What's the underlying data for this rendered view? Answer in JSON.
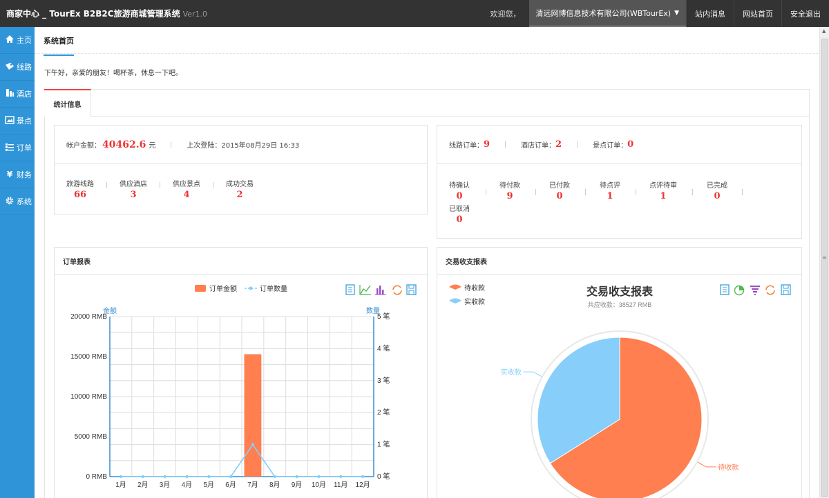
{
  "header": {
    "title": "商家中心 _ TourEx B2B2C旅游商城管理系统",
    "version": "Ver1.0",
    "welcome": "欢迎您，",
    "company": "清远网博信息技术有限公司(WBTourEx)",
    "nav": [
      "站内消息",
      "网站首页",
      "安全退出"
    ]
  },
  "sidebar": {
    "items": [
      {
        "label": "主页",
        "icon": "home-icon"
      },
      {
        "label": "线路",
        "icon": "route-icon"
      },
      {
        "label": "酒店",
        "icon": "hotel-icon"
      },
      {
        "label": "景点",
        "icon": "scenery-icon"
      },
      {
        "label": "订单",
        "icon": "list-icon"
      },
      {
        "label": "财务",
        "icon": "yen-icon"
      },
      {
        "label": "系统",
        "icon": "gear-icon"
      }
    ]
  },
  "page": {
    "tab": "系统首页",
    "greeting": "下午好，亲爱的朋友！喝杯茶，休息一下吧。",
    "panel_tab": "统计信息"
  },
  "account": {
    "balance_label": "帐户金额：",
    "balance": "40462.6",
    "balance_unit": "元",
    "last_login": "上次登陆：2015年08月29日 16:33",
    "stats": [
      {
        "label": "旅游线路",
        "value": "66"
      },
      {
        "label": "供应酒店",
        "value": "3"
      },
      {
        "label": "供应景点",
        "value": "4"
      },
      {
        "label": "成功交易",
        "value": "2"
      }
    ]
  },
  "orders": {
    "counts": [
      {
        "label": "线路订单：",
        "value": "9"
      },
      {
        "label": "酒店订单：",
        "value": "2"
      },
      {
        "label": "景点订单：",
        "value": "0"
      }
    ],
    "status": [
      {
        "label": "待确认",
        "value": "0"
      },
      {
        "label": "待付款",
        "value": "9"
      },
      {
        "label": "已付款",
        "value": "0"
      },
      {
        "label": "待点评",
        "value": "1"
      },
      {
        "label": "点评待审",
        "value": "1"
      },
      {
        "label": "已完成",
        "value": "0"
      },
      {
        "label": "已取消",
        "value": "0"
      }
    ]
  },
  "order_report": {
    "title": "订单报表",
    "legend": [
      "订单金额",
      "订单数量"
    ],
    "left_axis_label": "金额",
    "right_axis_label": "数量"
  },
  "trade_report": {
    "box_title": "交易收支报表",
    "title": "交易收支报表",
    "subtitle": "共应收款：38527 RMB",
    "legend": [
      "待收款",
      "实收款"
    ]
  },
  "colors": {
    "orange": "#ff7f50",
    "blue": "#87cefa",
    "sidebar": "#2f95d8",
    "red_value": "#e33333"
  },
  "chart_data": [
    {
      "type": "bar",
      "title": "",
      "categories": [
        "1月",
        "2月",
        "3月",
        "4月",
        "5月",
        "6月",
        "7月",
        "8月",
        "9月",
        "10月",
        "11月",
        "12月"
      ],
      "series": [
        {
          "name": "订单金额",
          "type": "bar",
          "axis": "left",
          "values": [
            0,
            0,
            0,
            0,
            0,
            0,
            15300,
            0,
            0,
            0,
            0,
            0
          ]
        },
        {
          "name": "订单数量",
          "type": "line",
          "axis": "right",
          "values": [
            0,
            0,
            0,
            0,
            0,
            0,
            1,
            0,
            0,
            0,
            0,
            0
          ]
        }
      ],
      "ylabel": "金额",
      "ylabel_right": "数量",
      "ylim": [
        0,
        20000
      ],
      "ylim_right": [
        0,
        5
      ],
      "yticks": [
        "0 RMB",
        "5000 RMB",
        "10000 RMB",
        "15000 RMB",
        "20000 RMB"
      ],
      "yticks_right": [
        "0 笔",
        "1 笔",
        "2 笔",
        "3 笔",
        "4 笔",
        "5 笔"
      ],
      "grid": true,
      "legend_position": "top-center"
    },
    {
      "type": "pie",
      "title": "交易收支报表",
      "subtitle": "共应收款：38527 RMB",
      "categories": [
        "待收款",
        "实收款"
      ],
      "values": [
        25430,
        13097
      ],
      "legend_position": "top-left"
    }
  ]
}
